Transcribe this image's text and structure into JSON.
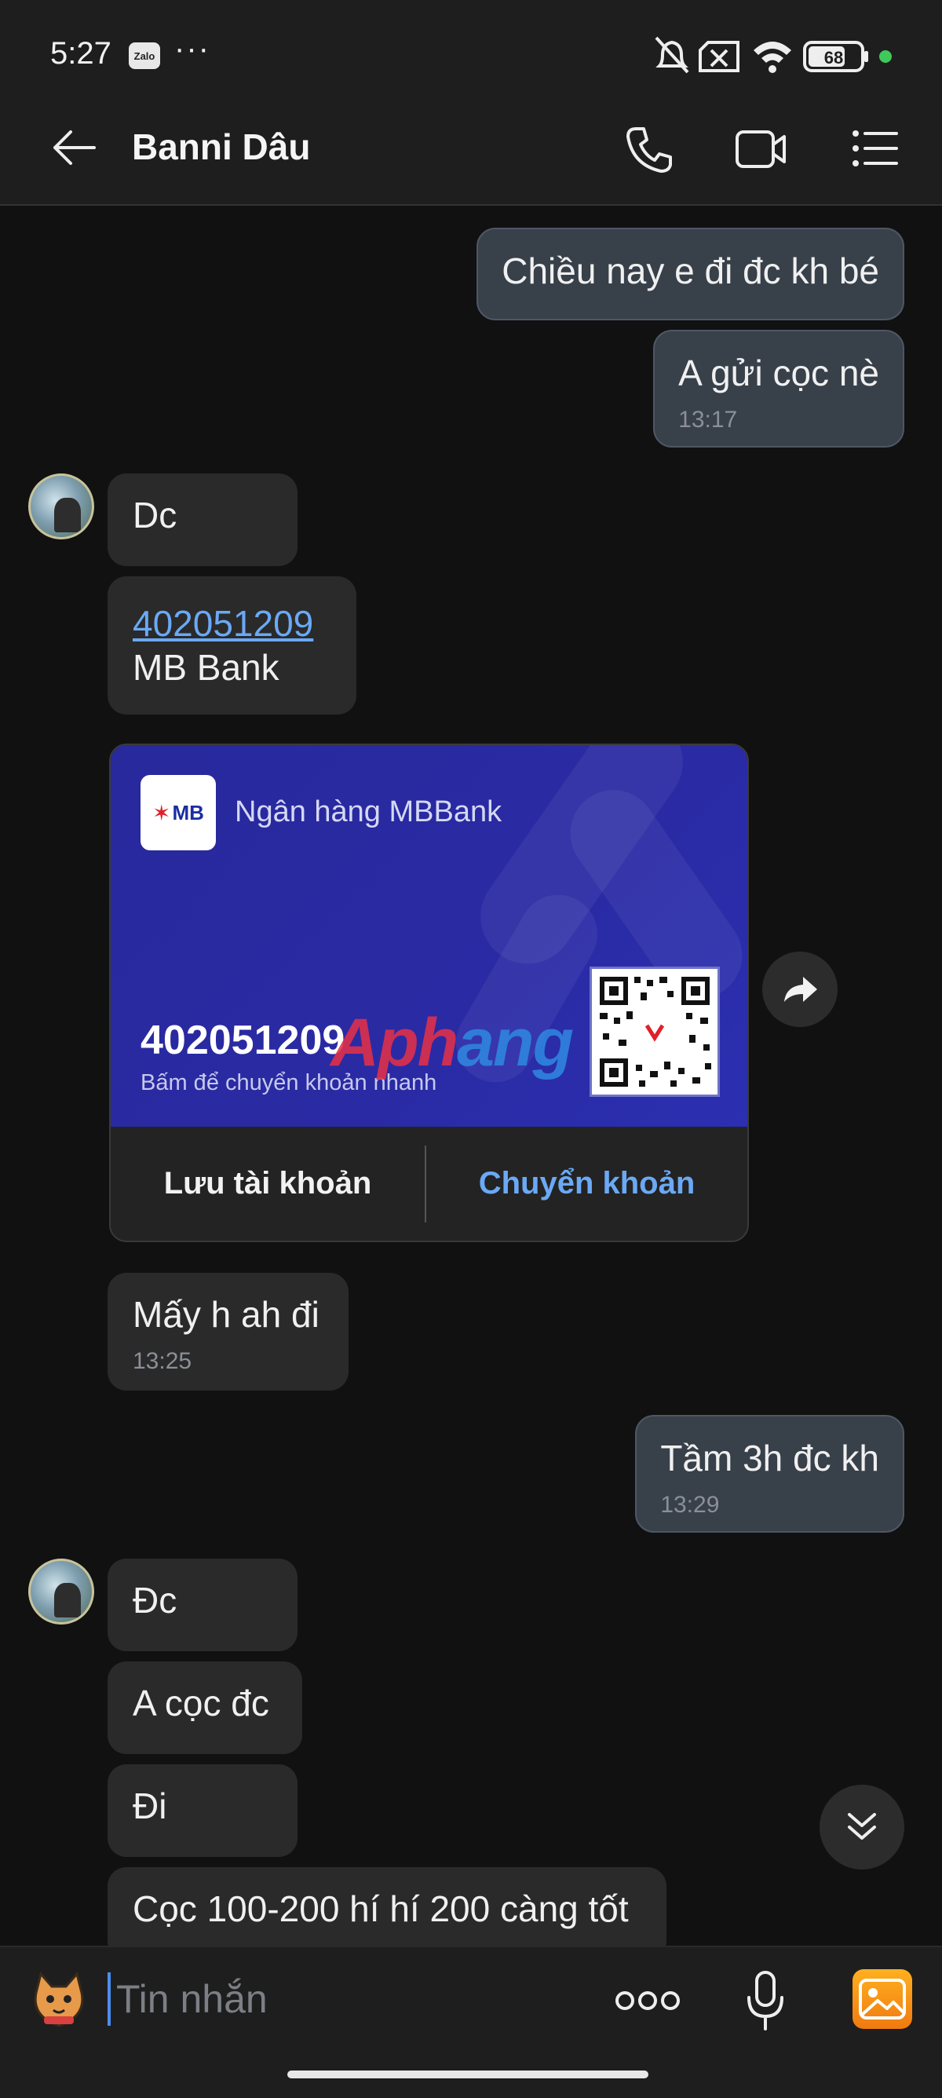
{
  "status_bar": {
    "time": "5:27",
    "app_icon_label": "Zalo",
    "more": "···",
    "battery": "68"
  },
  "header": {
    "contact_name": "Banni Dâu"
  },
  "messages": [
    {
      "side": "out",
      "text": "Chiều nay e đi đc kh bé"
    },
    {
      "side": "out",
      "text": "A gửi cọc nè",
      "time": "13:17"
    },
    {
      "side": "in",
      "text": "Dc"
    },
    {
      "side": "in",
      "text": "402051209",
      "text2": "MB Bank"
    },
    {
      "side": "in",
      "text": "Mấy h ah đi",
      "time": "13:25"
    },
    {
      "side": "out",
      "text": "Tầm 3h đc kh",
      "time": "13:29"
    },
    {
      "side": "in",
      "text": "Đc"
    },
    {
      "side": "in",
      "text": "A cọc đc"
    },
    {
      "side": "in",
      "text": "Đi"
    },
    {
      "side": "in",
      "text": "Cọc 100-200 hí hí 200 càng tốt"
    }
  ],
  "bank_card": {
    "logo_text": "MB",
    "bank_name": "Ngân hàng MBBank",
    "account_number": "402051209",
    "hint": "Bấm để chuyển khoản nhanh",
    "save_label": "Lưu tài khoản",
    "transfer_label": "Chuyển khoản",
    "watermark": "Aphang"
  },
  "input": {
    "placeholder": "Tin nhắn"
  },
  "colors": {
    "background": "#111111",
    "incoming_bubble": "#2a2a2a",
    "outgoing_bubble": "#38404a",
    "link": "#6aa9f5",
    "card_blue": "#2a2aa4"
  }
}
